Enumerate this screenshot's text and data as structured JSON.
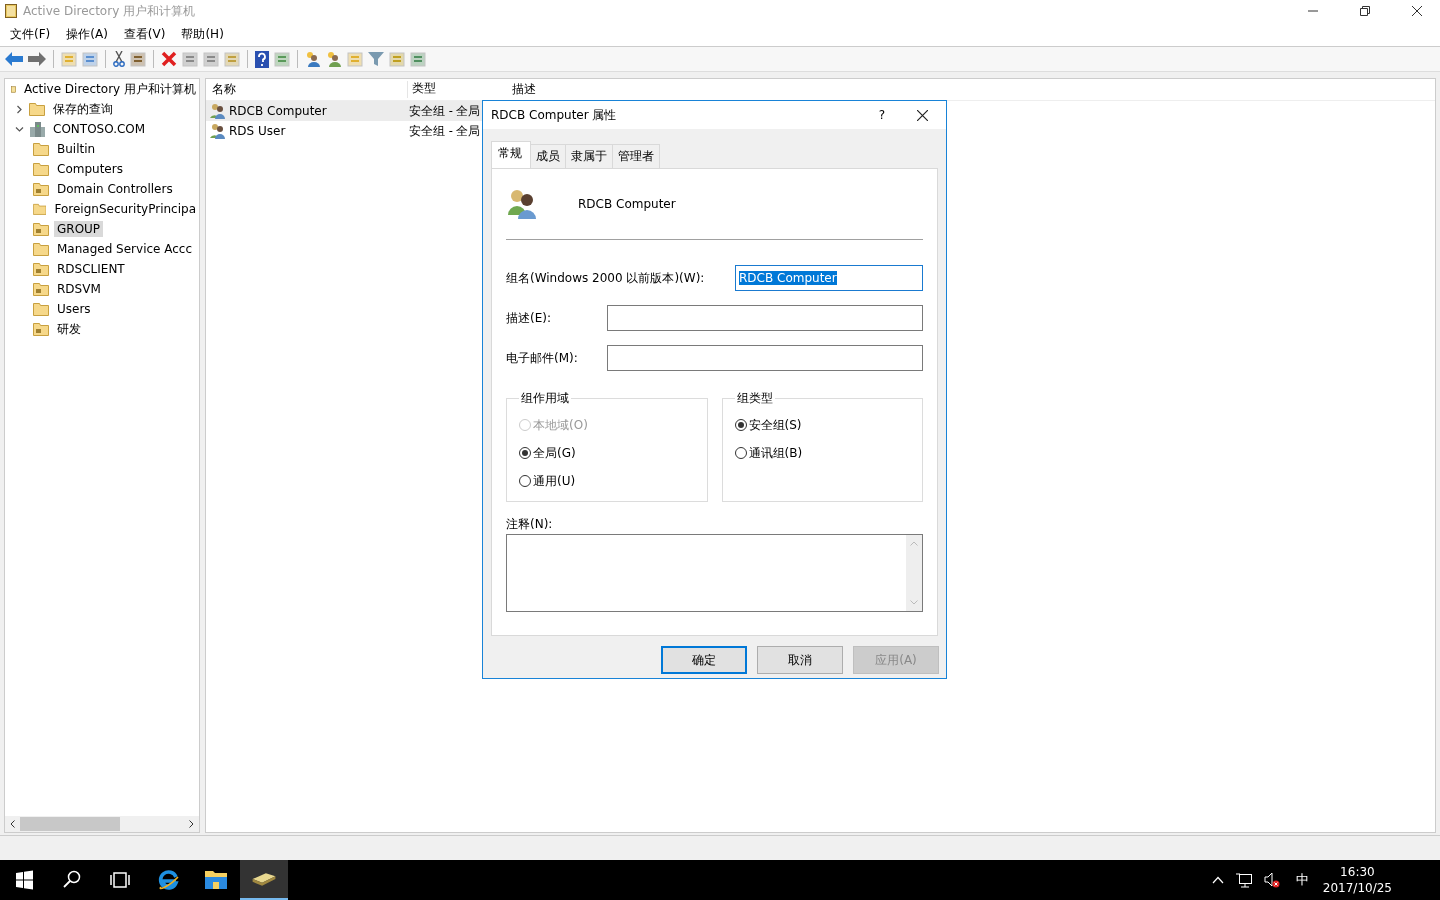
{
  "window": {
    "title": "Active Directory 用户和计算机"
  },
  "menu": [
    "文件(F)",
    "操作(A)",
    "查看(V)",
    "帮助(H)"
  ],
  "tree": {
    "label": "Active Directory 用户和计算机",
    "children": [
      {
        "label": "保存的查询",
        "kind": "folder",
        "expanded": false,
        "selected": false
      },
      {
        "label": "CONTOSO.COM",
        "kind": "domain",
        "expanded": true,
        "selected": false,
        "children": [
          {
            "label": "Builtin",
            "kind": "folder",
            "selected": false
          },
          {
            "label": "Computers",
            "kind": "folder",
            "selected": false
          },
          {
            "label": "Domain Controllers",
            "kind": "ou",
            "selected": false
          },
          {
            "label": "ForeignSecurityPrincipa",
            "kind": "folder",
            "selected": false
          },
          {
            "label": "GROUP",
            "kind": "ou",
            "selected": true
          },
          {
            "label": "Managed Service Accc",
            "kind": "folder",
            "selected": false
          },
          {
            "label": "RDSCLIENT",
            "kind": "ou",
            "selected": false
          },
          {
            "label": "RDSVM",
            "kind": "ou",
            "selected": false
          },
          {
            "label": "Users",
            "kind": "folder",
            "selected": false
          },
          {
            "label": "研发",
            "kind": "ou",
            "selected": false
          }
        ]
      }
    ]
  },
  "list": {
    "columns": [
      "名称",
      "类型",
      "描述"
    ],
    "rows": [
      {
        "name": "RDCB Computer",
        "type": "安全组 - 全局",
        "selected": true
      },
      {
        "name": "RDS User",
        "type": "安全组 - 全局",
        "selected": false
      }
    ]
  },
  "dialog": {
    "title": "RDCB Computer 属性",
    "help": "?",
    "tabs": [
      {
        "label": "常规",
        "selected": true
      },
      {
        "label": "成员",
        "selected": false
      },
      {
        "label": "隶属于",
        "selected": false
      },
      {
        "label": "管理者",
        "selected": false
      }
    ],
    "object_name": "RDCB Computer",
    "fields": [
      {
        "label": "组名(Windows 2000 以前版本)(W):",
        "value": "RDCB Computer",
        "focused": true
      },
      {
        "label": "描述(E):",
        "focused": false
      },
      {
        "label": "电子邮件(M):",
        "focused": false
      }
    ],
    "groups": [
      {
        "title": "组作用域",
        "options": [
          {
            "label": "本地域(O)",
            "selected": false,
            "disabled": true
          },
          {
            "label": "全局(G)",
            "selected": true,
            "disabled": false
          },
          {
            "label": "通用(U)",
            "selected": false,
            "disabled": false
          }
        ]
      },
      {
        "title": "组类型",
        "options": [
          {
            "label": "安全组(S)",
            "selected": true,
            "disabled": false
          },
          {
            "label": "通讯组(B)",
            "selected": false,
            "disabled": false
          }
        ]
      }
    ],
    "notes_label": "注释(N):",
    "buttons": [
      {
        "label": "确定",
        "default": true,
        "disabled": false
      },
      {
        "label": "取消",
        "default": false,
        "disabled": false
      },
      {
        "label": "应用(A)",
        "default": false,
        "disabled": true
      }
    ]
  },
  "taskbar": {
    "ime": "中",
    "time": "16:30",
    "date": "2017/10/25"
  }
}
